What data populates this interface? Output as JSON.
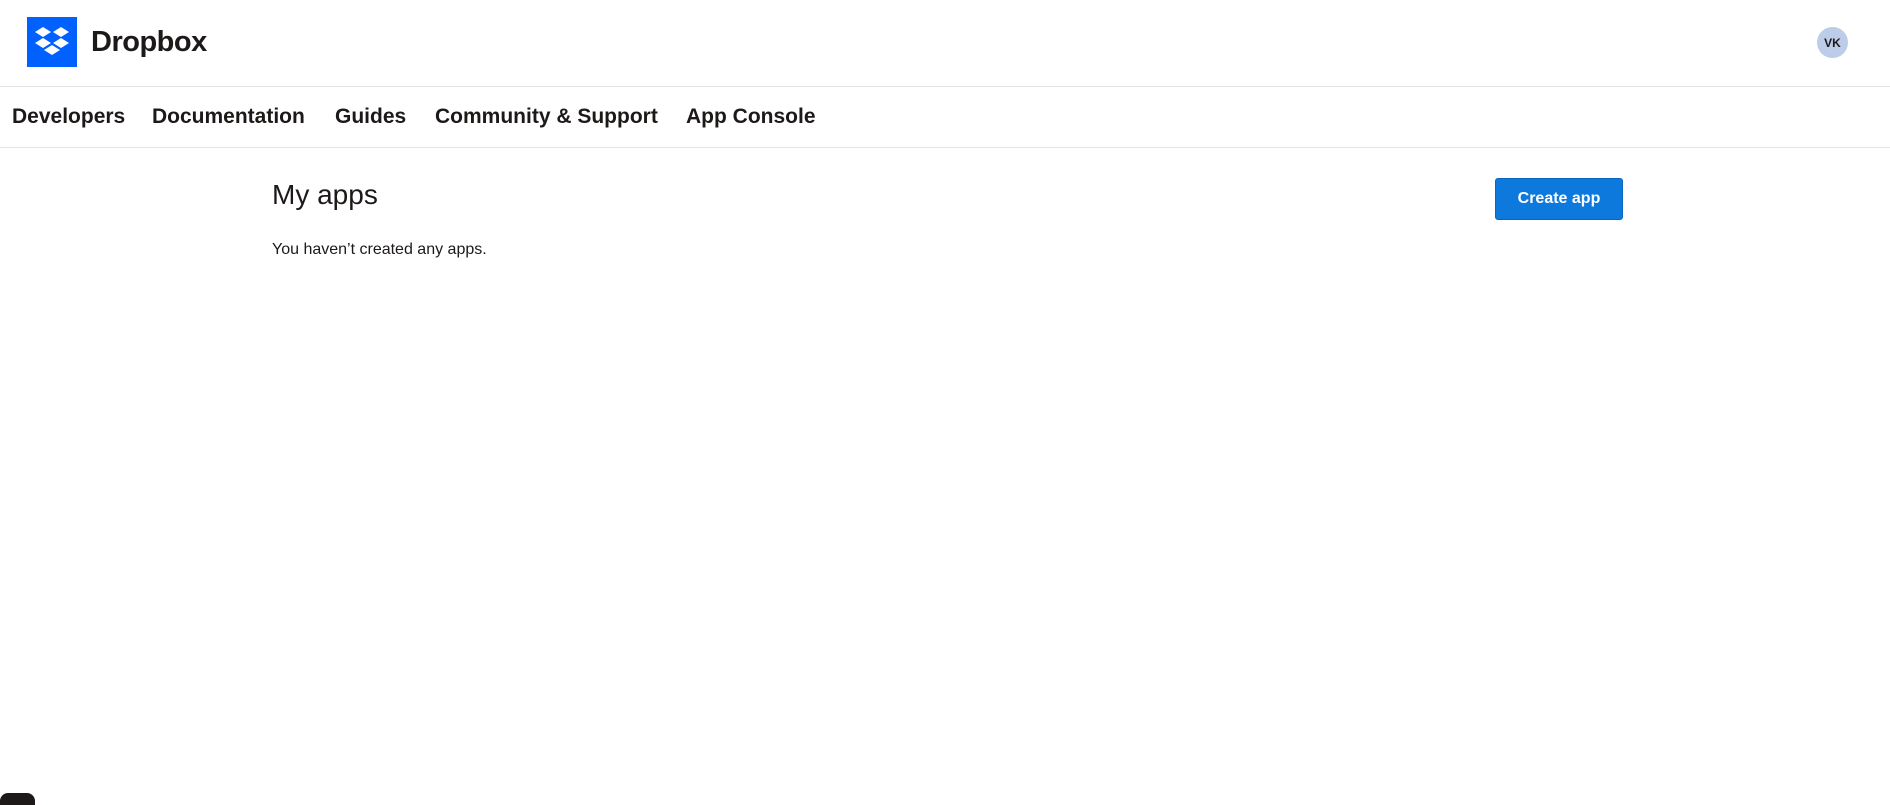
{
  "header": {
    "brand_name": "Dropbox",
    "logo_icon": "dropbox-logo-icon",
    "brand_color": "#0061fe",
    "avatar_initials": "VK",
    "avatar_color": "#bccce9"
  },
  "subnav": {
    "items": [
      {
        "label": "Developers"
      },
      {
        "label": "Documentation"
      },
      {
        "label": "Guides"
      },
      {
        "label": "Community & Support"
      },
      {
        "label": "App Console"
      }
    ]
  },
  "main": {
    "title": "My apps",
    "empty_message": "You haven’t created any apps.",
    "create_button_label": "Create app",
    "button_color": "#0e79dd"
  }
}
